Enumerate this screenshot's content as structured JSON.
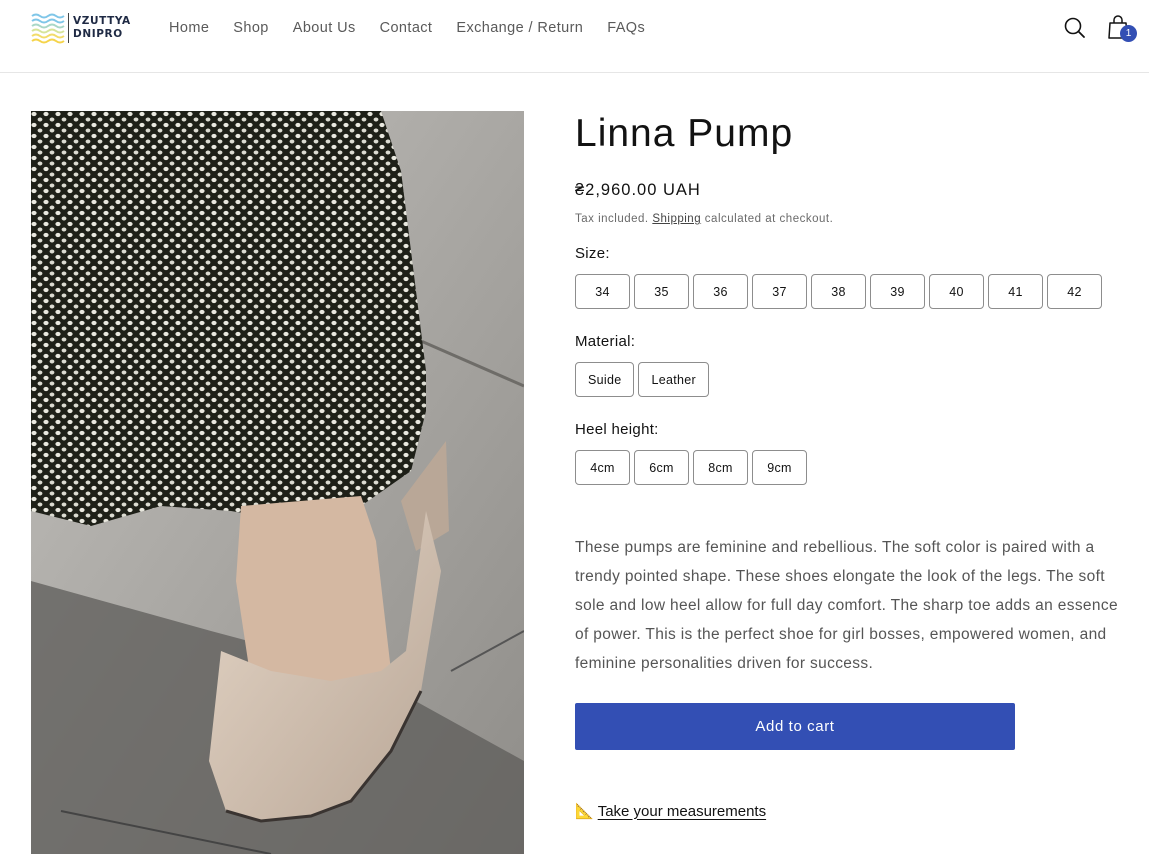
{
  "header": {
    "logo_line1": "VZUTTYA",
    "logo_line2": "DNIPRO",
    "nav": [
      {
        "label": "Home"
      },
      {
        "label": "Shop"
      },
      {
        "label": "About Us"
      },
      {
        "label": "Contact"
      },
      {
        "label": "Exchange / Return"
      },
      {
        "label": "FAQs"
      }
    ],
    "search_icon": "search-icon",
    "cart_icon": "shopping-bag-icon",
    "cart_count": "1"
  },
  "product": {
    "title": "Linna Pump",
    "price": "₴2,960.00 UAH",
    "tax_prefix": "Tax included.",
    "tax_link": "Shipping",
    "tax_suffix": "calculated at checkout.",
    "size_label": "Size:",
    "sizes": [
      "34",
      "35",
      "36",
      "37",
      "38",
      "39",
      "40",
      "41",
      "42"
    ],
    "material_label": "Material:",
    "materials": [
      "Suide",
      "Leather"
    ],
    "heel_label": "Heel height:",
    "heels": [
      "4cm",
      "6cm",
      "8cm",
      "9cm"
    ],
    "description": "These pumps are feminine and rebellious. The soft color is paired with a trendy pointed shape. These shoes elongate the look of the legs. The soft sole and low heel allow for full day comfort. The sharp toe adds an essence of power. This is the perfect shoe for girl bosses, empowered women, and feminine personalities driven for success.",
    "add_to_cart": "Add to cart",
    "measure_icon": "📐",
    "measure_label": "Take your measurements"
  },
  "colors": {
    "accent": "#334fb4",
    "text": "#121212",
    "muted": "#555555"
  }
}
